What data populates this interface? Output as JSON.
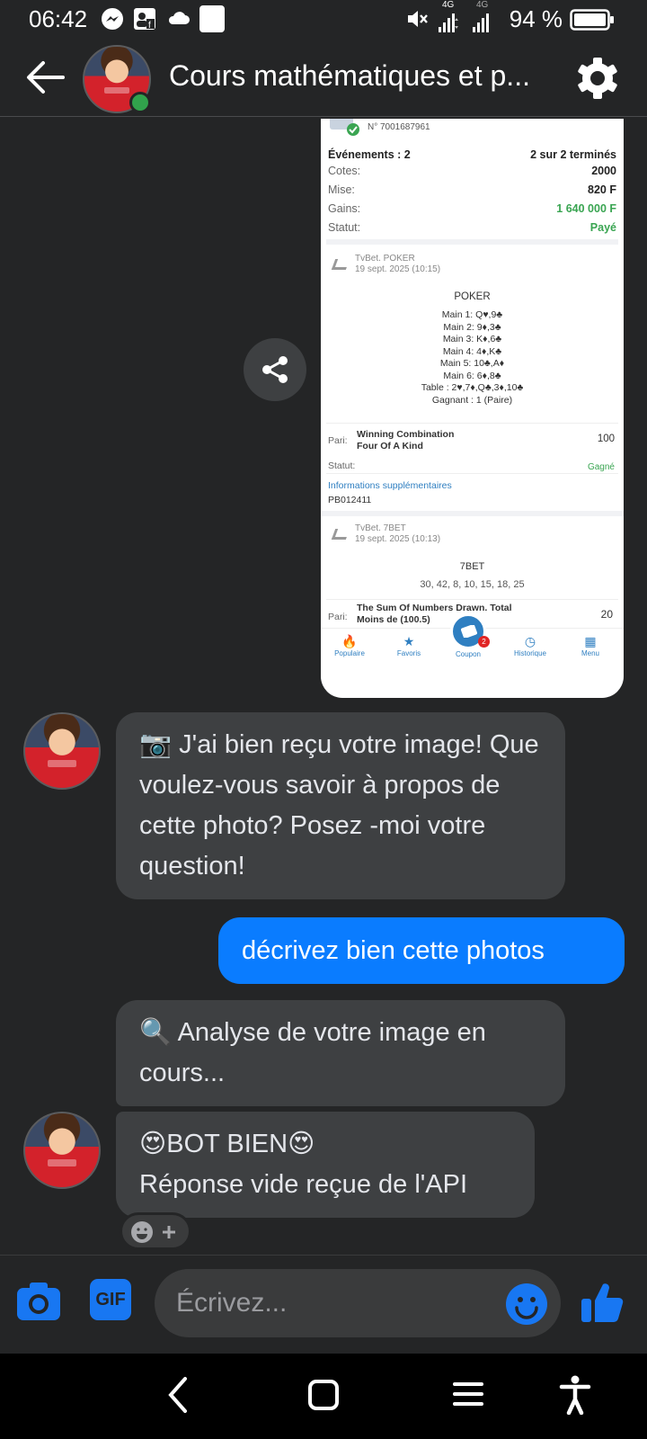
{
  "status_bar": {
    "time": "06:42",
    "battery_pct": "94 %",
    "net1": "4G",
    "net2": "4G",
    "left_icons": [
      "messenger-icon",
      "facebook-contact-icon",
      "cloud-icon",
      "square-notification-icon"
    ],
    "right_icons": [
      "mute-icon",
      "signal-icon",
      "signal-icon",
      "battery-icon"
    ]
  },
  "header": {
    "title": "Cours mathématiques et p...",
    "back_icon": "back-arrow-icon",
    "settings_icon": "gear-icon"
  },
  "shared_image": {
    "coupon_no": "N° 7001687961",
    "events_label": "Événements : 2",
    "events_done": "2 sur 2 terminés",
    "rows": [
      {
        "label": "Cotes:",
        "value": "2000"
      },
      {
        "label": "Mise:",
        "value": "820 F"
      },
      {
        "label": "Gains:",
        "value": "1 640 000 F"
      },
      {
        "label": "Statut:",
        "value": "Payé"
      }
    ],
    "bet1": {
      "provider": "TvBet. POKER",
      "date": "19 sept. 2025 (10:15)",
      "game": "POKER",
      "lines": [
        "Main 1: Q♥,9♣",
        "Main 2: 9♦,3♣",
        "Main 3: K♦,6♣",
        "Main 4: 4♦,K♣",
        "Main 5: 10♣,A♦",
        "Main 6: 6♦,8♣",
        "Table : 2♥,7♦,Q♣,3♦,10♣",
        "Gagnant : 1 (Paire)"
      ],
      "pari_label": "Pari:",
      "pari_name": "Winning Combination",
      "pari_detail": "Four Of A Kind",
      "pari_value": "100",
      "statut_label": "Statut:",
      "statut_value": "Gagné",
      "info_label": "Informations supplémentaires",
      "info_value": "PB012411"
    },
    "bet2": {
      "provider": "TvBet. 7BET",
      "date": "19 sept. 2025 (10:13)",
      "game": "7BET",
      "numbers": "30, 42, 8, 10, 15, 18, 25",
      "pari_label": "Pari:",
      "pari_name": "The Sum Of Numbers Drawn. Total",
      "pari_detail": "Moins de (100.5)",
      "pari_value": "20"
    },
    "tabs": [
      "Populaire",
      "Favoris",
      "Coupon",
      "Historique",
      "Menu"
    ],
    "coupon_badge": "2"
  },
  "messages": [
    {
      "from": "bot",
      "text": "📷 J'ai bien reçu votre image! Que voulez-vous savoir à propos de cette photo? Posez -moi votre question!"
    },
    {
      "from": "me",
      "text": "décrivez bien cette photos"
    },
    {
      "from": "bot",
      "text": "🔍 Analyse de votre image en cours..."
    },
    {
      "from": "bot",
      "line1": "😍BOT BIEN😍",
      "line2": "Réponse vide reçue de l'API"
    }
  ],
  "composer": {
    "placeholder": "Écrivez...",
    "gif_label": "GIF"
  },
  "colors": {
    "background": "#242526",
    "bubble_bot": "#3e4042",
    "bubble_me": "#0a7cff",
    "accent": "#1877f2"
  }
}
